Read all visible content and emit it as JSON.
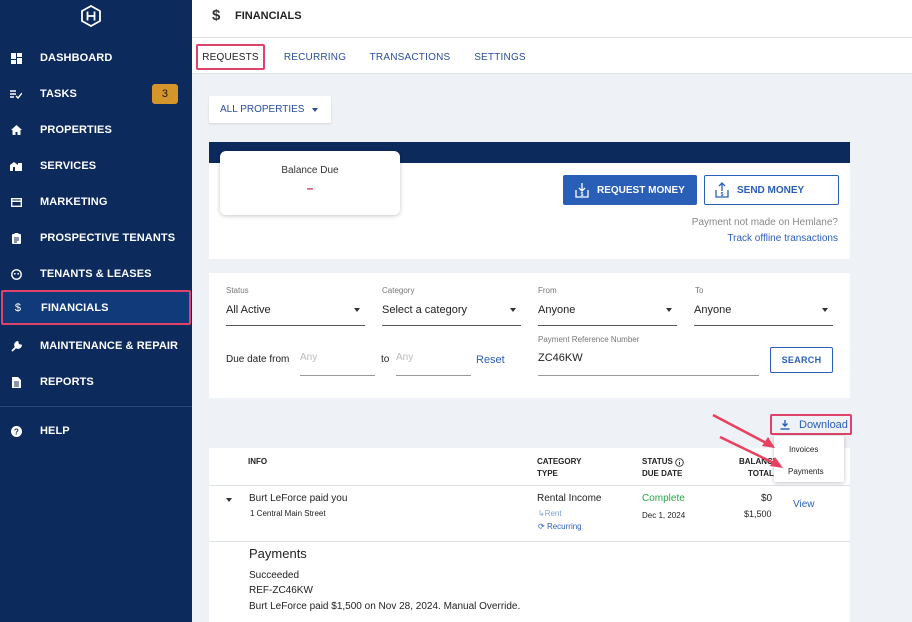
{
  "sidebar": {
    "items": [
      {
        "label": "DASHBOARD",
        "icon": "dashboard-icon"
      },
      {
        "label": "TASKS",
        "icon": "tasks-icon",
        "badge": "3"
      },
      {
        "label": "PROPERTIES",
        "icon": "home-icon"
      },
      {
        "label": "SERVICES",
        "icon": "services-icon"
      },
      {
        "label": "MARKETING",
        "icon": "marketing-icon"
      },
      {
        "label": "PROSPECTIVE TENANTS",
        "icon": "clipboard-icon"
      },
      {
        "label": "TENANTS & LEASES",
        "icon": "tenants-icon"
      },
      {
        "label": "FINANCIALS",
        "icon": "dollar-icon"
      },
      {
        "label": "MAINTENANCE & REPAIR",
        "icon": "wrench-icon"
      },
      {
        "label": "REPORTS",
        "icon": "report-icon"
      },
      {
        "label": "HELP",
        "icon": "help-icon"
      }
    ]
  },
  "header": {
    "icon": "$",
    "title": "FINANCIALS"
  },
  "tabs": [
    "REQUESTS",
    "RECURRING",
    "TRANSACTIONS",
    "SETTINGS"
  ],
  "properties_filter": "ALL PROPERTIES",
  "balance": {
    "label": "Balance Due",
    "value": "–",
    "request_money": "REQUEST MONEY",
    "send_money": "SEND MONEY",
    "not_made": "Payment not made on Hemlane?",
    "track": "Track offline transactions"
  },
  "filters": {
    "status_label": "Status",
    "status_value": "All Active",
    "category_label": "Category",
    "category_value": "Select a category",
    "from_label": "From",
    "from_value": "Anyone",
    "to_label": "To",
    "to_value": "Anyone",
    "due_from_label": "Due date from",
    "due_from_placeholder": "Any",
    "to_text": "to",
    "due_to_placeholder": "Any",
    "reset": "Reset",
    "ref_label": "Payment Reference Number",
    "ref_value": "ZC46KW",
    "search": "SEARCH"
  },
  "download": {
    "label": "Download",
    "menu": [
      "Invoices",
      "Payments"
    ]
  },
  "table": {
    "headers": {
      "info": "INFO",
      "category": "CATEGORY",
      "type": "TYPE",
      "status": "STATUS",
      "due_date": "DUE DATE",
      "balance": "BALANCE",
      "total": "TOTAL"
    },
    "row": {
      "title": "Burt LeForce paid you",
      "address": "1 Central Main Street",
      "category": "Rental Income",
      "subcategory": "Rent",
      "recurring": "Recurring",
      "status": "Complete",
      "due_date": "Dec 1, 2024",
      "balance": "$0",
      "total": "$1,500",
      "action": "View"
    },
    "payments": {
      "title": "Payments",
      "status": "Succeeded",
      "ref": "REF-ZC46KW",
      "note": "Burt LeForce paid $1,500 on Nov 28, 2024. Manual Override."
    }
  }
}
